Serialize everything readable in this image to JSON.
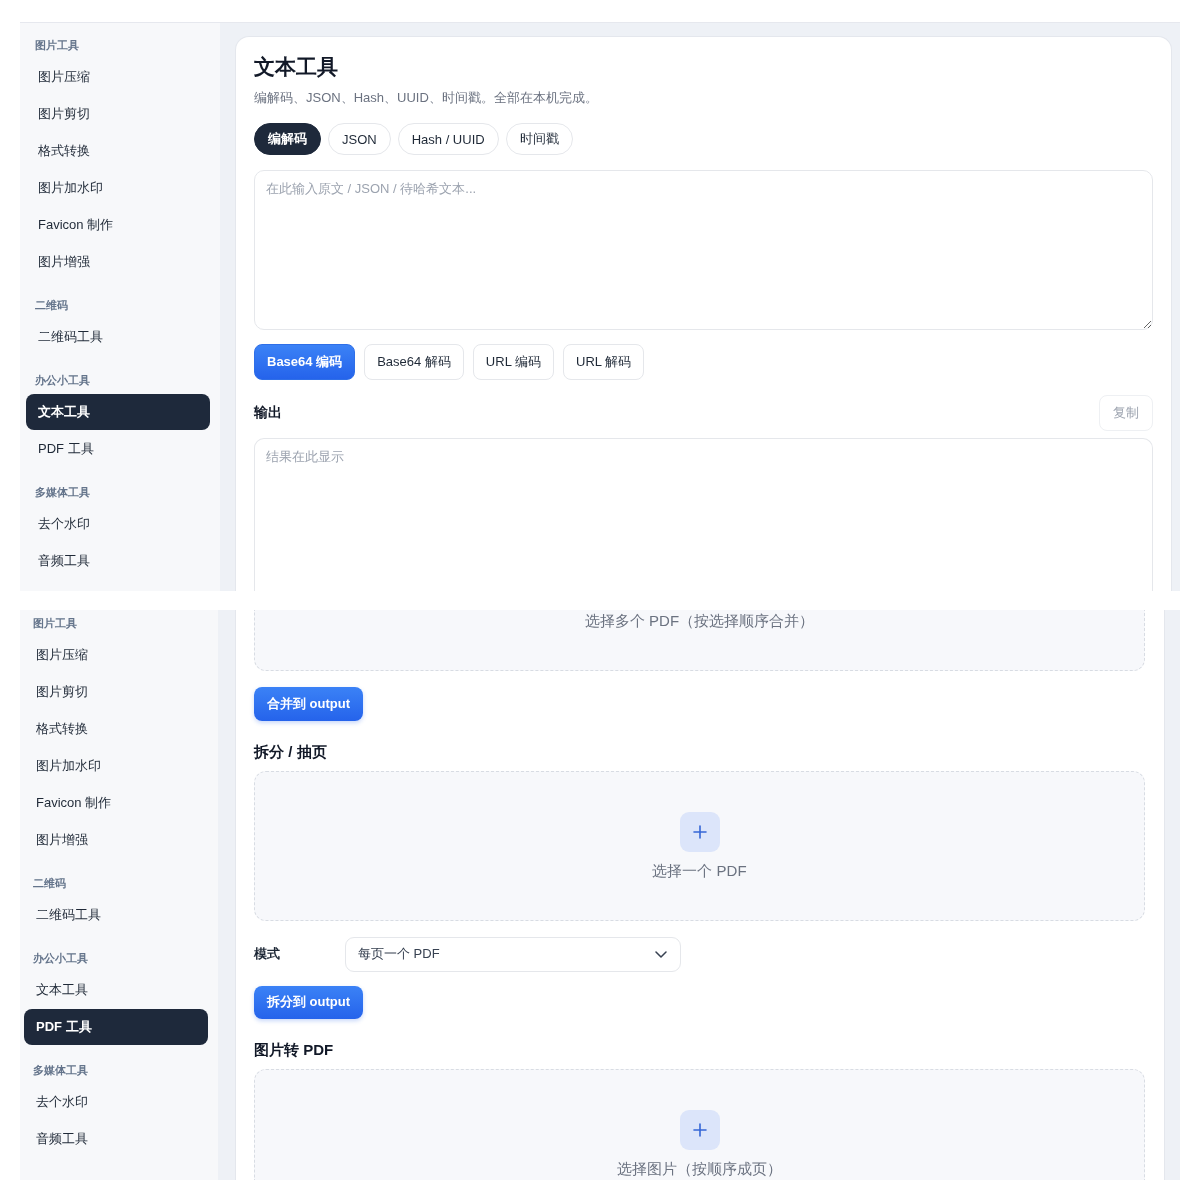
{
  "screens": [
    {
      "kind": "text_tool",
      "sidebar": {
        "sections": [
          {
            "title": "图片工具",
            "items": [
              {
                "label": "图片压缩",
                "selected": false
              },
              {
                "label": "图片剪切",
                "selected": false
              },
              {
                "label": "格式转换",
                "selected": false
              },
              {
                "label": "图片加水印",
                "selected": false
              },
              {
                "label": "Favicon 制作",
                "selected": false
              },
              {
                "label": "图片增强",
                "selected": false
              }
            ]
          },
          {
            "title": "二维码",
            "items": [
              {
                "label": "二维码工具",
                "selected": false
              }
            ]
          },
          {
            "title": "办公小工具",
            "items": [
              {
                "label": "文本工具",
                "selected": true
              },
              {
                "label": "PDF 工具",
                "selected": false
              }
            ]
          },
          {
            "title": "多媒体工具",
            "items": [
              {
                "label": "去个水印",
                "selected": false
              },
              {
                "label": "音频工具",
                "selected": false
              }
            ]
          }
        ]
      },
      "content": {
        "title": "文本工具",
        "subtitle": "编解码、JSON、Hash、UUID、时间戳。全部在本机完成。",
        "tabs": [
          {
            "label": "编解码",
            "selected": true
          },
          {
            "label": "JSON",
            "selected": false
          },
          {
            "label": "Hash / UUID",
            "selected": false
          },
          {
            "label": "时间戳",
            "selected": false
          }
        ],
        "input": {
          "placeholder": "在此输入原文 / JSON / 待哈希文本..."
        },
        "actions": [
          {
            "label": "Base64 编码",
            "selected": true
          },
          {
            "label": "Base64 解码",
            "selected": false
          },
          {
            "label": "URL 编码",
            "selected": false
          },
          {
            "label": "URL 解码",
            "selected": false
          }
        ],
        "output": {
          "label": "输出",
          "copy_button": {
            "label": "复制",
            "disabled": true
          },
          "placeholder": "结果在此显示"
        }
      }
    },
    {
      "kind": "pdf_tool",
      "sidebar": {
        "sections": [
          {
            "title": "图片工具",
            "items": [
              {
                "label": "图片压缩",
                "selected": false
              },
              {
                "label": "图片剪切",
                "selected": false
              },
              {
                "label": "格式转换",
                "selected": false
              },
              {
                "label": "图片加水印",
                "selected": false
              },
              {
                "label": "Favicon 制作",
                "selected": false
              },
              {
                "label": "图片增强",
                "selected": false
              }
            ]
          },
          {
            "title": "二维码",
            "items": [
              {
                "label": "二维码工具",
                "selected": false
              }
            ]
          },
          {
            "title": "办公小工具",
            "items": [
              {
                "label": "文本工具",
                "selected": false
              },
              {
                "label": "PDF 工具",
                "selected": true
              }
            ]
          },
          {
            "title": "多媒体工具",
            "items": [
              {
                "label": "去个水印",
                "selected": false
              },
              {
                "label": "音频工具",
                "selected": false
              }
            ]
          }
        ]
      },
      "content": {
        "blocks": [
          {
            "kind": "dropzone",
            "text": "选择多个 PDF（按选择顺序合并）",
            "clipped_top": true,
            "clipped_bottom": false
          },
          {
            "kind": "button",
            "label": "合并到 output"
          },
          {
            "kind": "heading",
            "text": "拆分 / 抽页"
          },
          {
            "kind": "dropzone",
            "text": "选择一个 PDF",
            "clipped_top": false,
            "clipped_bottom": false
          },
          {
            "kind": "select",
            "label": "模式",
            "value": "每页一个 PDF"
          },
          {
            "kind": "button",
            "label": "拆分到 output"
          },
          {
            "kind": "heading",
            "text": "图片转 PDF"
          },
          {
            "kind": "dropzone",
            "text": "选择图片（按顺序成页）",
            "clipped_top": false,
            "clipped_bottom": true
          }
        ]
      }
    }
  ]
}
